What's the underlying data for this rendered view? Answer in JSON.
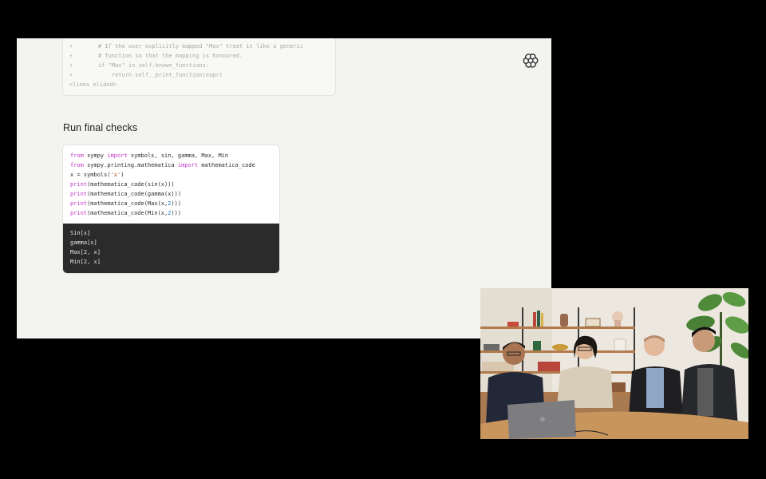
{
  "diff_lines": [
    {
      "marker": "+",
      "text": "# If the user explicitly mapped \"Max\" treat it like a generic"
    },
    {
      "marker": "+",
      "text": "# function so that the mapping is honoured."
    },
    {
      "marker": "+",
      "text": "if \"Max\" in self.known_functions:"
    },
    {
      "marker": "+",
      "text": "    return self._print_function(expr)"
    },
    {
      "marker": "",
      "text": "<lines elided>"
    }
  ],
  "section_title": "Run final checks",
  "code": {
    "line1": {
      "kw1": "from",
      "mod": " sympy ",
      "kw2": "import",
      "rest": " symbols, sin, gamma, Max, Min"
    },
    "line2": {
      "kw1": "from",
      "mod": " sympy.printing.mathematica ",
      "kw2": "import",
      "rest": " mathematica_code"
    },
    "line3": {
      "pre": "x = symbols(",
      "str": "'x'",
      "post": ")"
    },
    "line4": {
      "kw": "print",
      "rest": "(mathematica_code(sin(x)))"
    },
    "line5": {
      "kw": "print",
      "rest": "(mathematica_code(gamma(x)))"
    },
    "line6": {
      "kw": "print",
      "rest": "(mathematica_code(Max(x,",
      "num": "2",
      "post": ")))"
    },
    "line7": {
      "kw": "print",
      "rest": "(mathematica_code(Min(x,",
      "num": "2",
      "post": ")))"
    }
  },
  "output_lines": [
    "Sin[x]",
    "gamma[x]",
    "Max[2, x]",
    "Min[2, x]"
  ],
  "colors": {
    "keyword": "#c436c4",
    "string": "#c24a1a",
    "number": "#2a6fd6",
    "output_bg": "#2b2b2b"
  },
  "icons": {
    "logo": "openai-logo-icon"
  }
}
